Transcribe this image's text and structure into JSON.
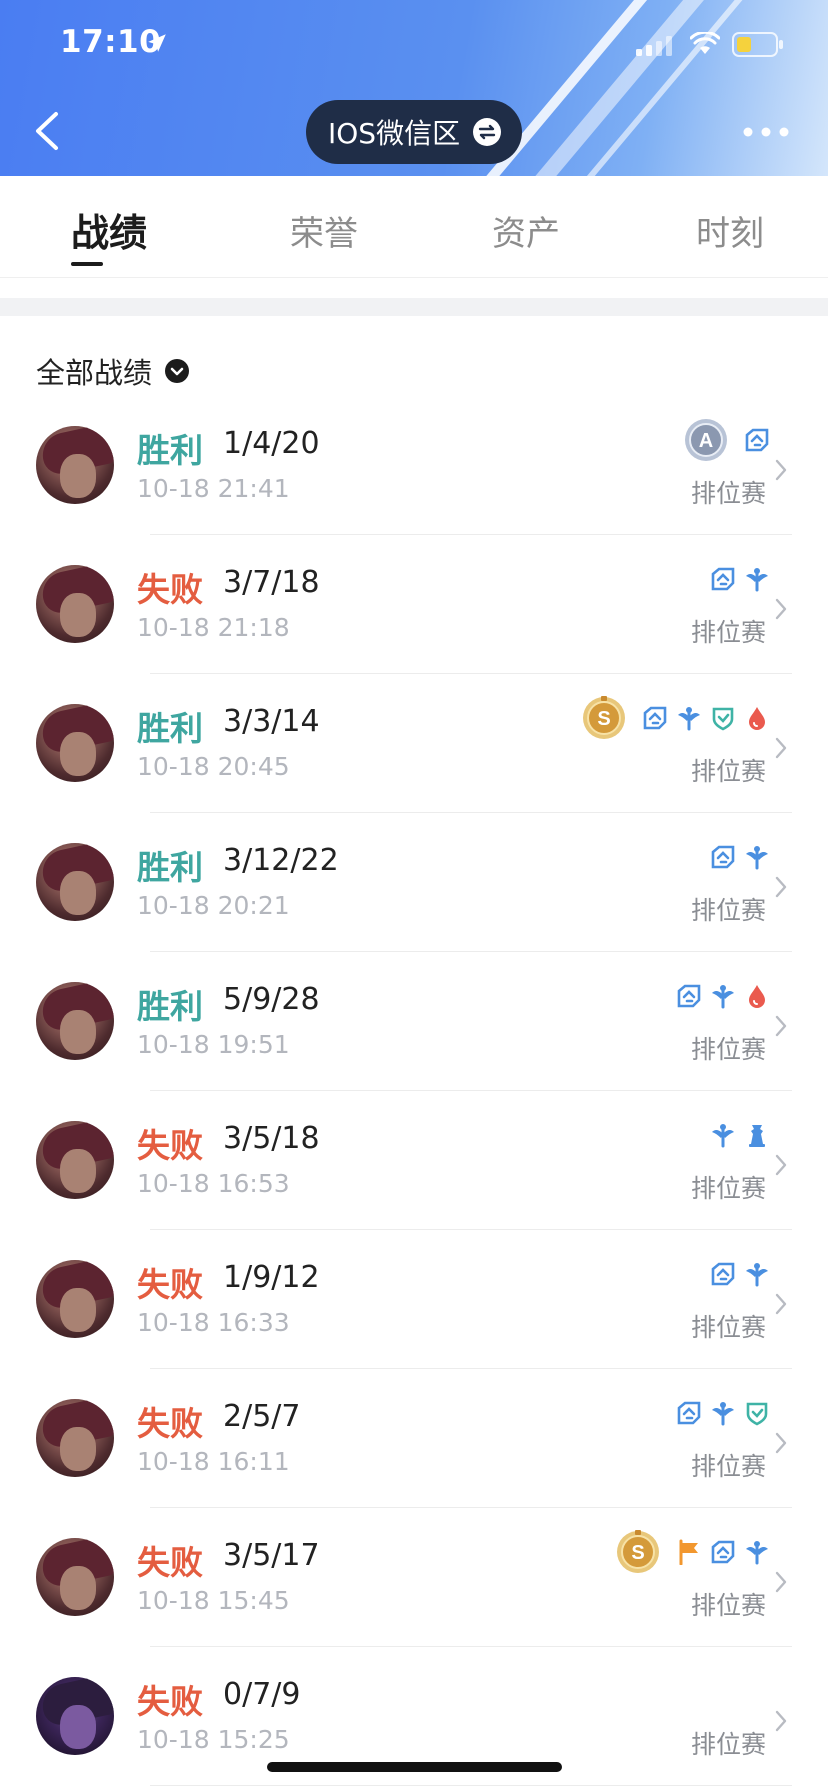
{
  "status_bar": {
    "time": "17:10"
  },
  "header": {
    "region": "IOS微信区"
  },
  "tabs": [
    {
      "label": "战绩",
      "active": true
    },
    {
      "label": "荣誉",
      "active": false
    },
    {
      "label": "资产",
      "active": false
    },
    {
      "label": "时刻",
      "active": false
    }
  ],
  "filter": {
    "label": "全部战绩"
  },
  "colors": {
    "win": "#3fa6a0",
    "loss": "#e45d40",
    "header_blue": "#4a7df2",
    "pill": "#1f2d47",
    "badge_blue": "#4a8fe0"
  },
  "matches": [
    {
      "result": "胜利",
      "outcome": "win",
      "kda": "1/4/20",
      "time": "10-18 21:41",
      "mode": "排位赛",
      "medal": "A",
      "badges": [
        "mvp-icon"
      ],
      "avatar": "hero-a"
    },
    {
      "result": "失败",
      "outcome": "loss",
      "kda": "3/7/18",
      "time": "10-18 21:18",
      "mode": "排位赛",
      "medal": "",
      "badges": [
        "mvp-icon",
        "wings-icon"
      ],
      "avatar": "hero-a"
    },
    {
      "result": "胜利",
      "outcome": "win",
      "kda": "3/3/14",
      "time": "10-18 20:45",
      "mode": "排位赛",
      "medal": "S",
      "badges": [
        "mvp-icon",
        "wings-icon",
        "shield-icon",
        "drop-icon"
      ],
      "avatar": "hero-a"
    },
    {
      "result": "胜利",
      "outcome": "win",
      "kda": "3/12/22",
      "time": "10-18 20:21",
      "mode": "排位赛",
      "medal": "",
      "badges": [
        "mvp-icon",
        "wings-icon"
      ],
      "avatar": "hero-a"
    },
    {
      "result": "胜利",
      "outcome": "win",
      "kda": "5/9/28",
      "time": "10-18 19:51",
      "mode": "排位赛",
      "medal": "",
      "badges": [
        "mvp-icon",
        "wings-icon",
        "drop-icon"
      ],
      "avatar": "hero-a"
    },
    {
      "result": "失败",
      "outcome": "loss",
      "kda": "3/5/18",
      "time": "10-18 16:53",
      "mode": "排位赛",
      "medal": "",
      "badges": [
        "wings-icon",
        "tower-icon"
      ],
      "avatar": "hero-a"
    },
    {
      "result": "失败",
      "outcome": "loss",
      "kda": "1/9/12",
      "time": "10-18 16:33",
      "mode": "排位赛",
      "medal": "",
      "badges": [
        "mvp-icon",
        "wings-icon"
      ],
      "avatar": "hero-a"
    },
    {
      "result": "失败",
      "outcome": "loss",
      "kda": "2/5/7",
      "time": "10-18 16:11",
      "mode": "排位赛",
      "medal": "",
      "badges": [
        "mvp-icon",
        "wings-icon",
        "shield-icon"
      ],
      "avatar": "hero-a"
    },
    {
      "result": "失败",
      "outcome": "loss",
      "kda": "3/5/17",
      "time": "10-18 15:45",
      "mode": "排位赛",
      "medal": "S",
      "badges": [
        "flag-icon",
        "mvp-icon",
        "wings-icon"
      ],
      "avatar": "hero-a"
    },
    {
      "result": "失败",
      "outcome": "loss",
      "kda": "0/7/9",
      "time": "10-18 15:25",
      "mode": "排位赛",
      "medal": "",
      "badges": [],
      "avatar": "hero-b"
    }
  ]
}
